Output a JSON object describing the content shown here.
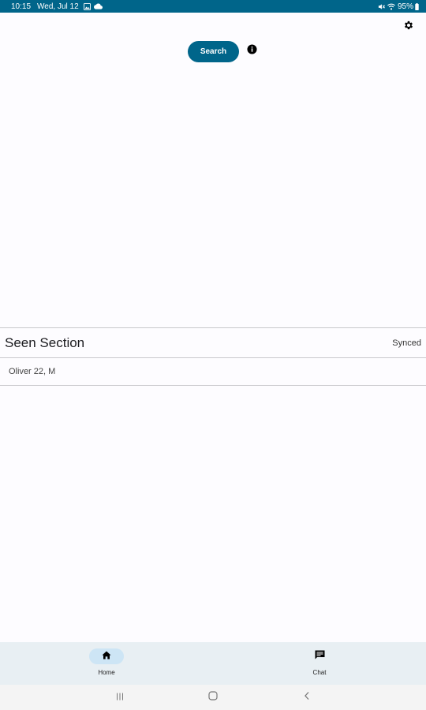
{
  "status_bar": {
    "time": "10:15",
    "date": "Wed, Jul 12",
    "battery": "95%",
    "icons_left": [
      "gallery-icon",
      "cloud-icon"
    ],
    "icons_right": [
      "mute-icon",
      "wifi-icon",
      "battery-icon"
    ]
  },
  "header": {
    "search_label": "Search",
    "settings_icon": "gear-icon",
    "info_icon": "info-icon"
  },
  "seen_section": {
    "title": "Seen Section",
    "status": "Synced",
    "items": [
      {
        "label": "Oliver 22, M"
      }
    ]
  },
  "bottom_nav": {
    "items": [
      {
        "label": "Home",
        "icon": "home-icon",
        "active": true
      },
      {
        "label": "Chat",
        "icon": "chat-icon",
        "active": false
      }
    ]
  },
  "system_nav": {
    "buttons": [
      "recents-icon",
      "home-circle-icon",
      "back-icon"
    ]
  },
  "colors": {
    "primary": "#00658a",
    "background": "#fdfcff",
    "nav_background": "#e8eff3",
    "active_pill": "#cde5f5"
  }
}
